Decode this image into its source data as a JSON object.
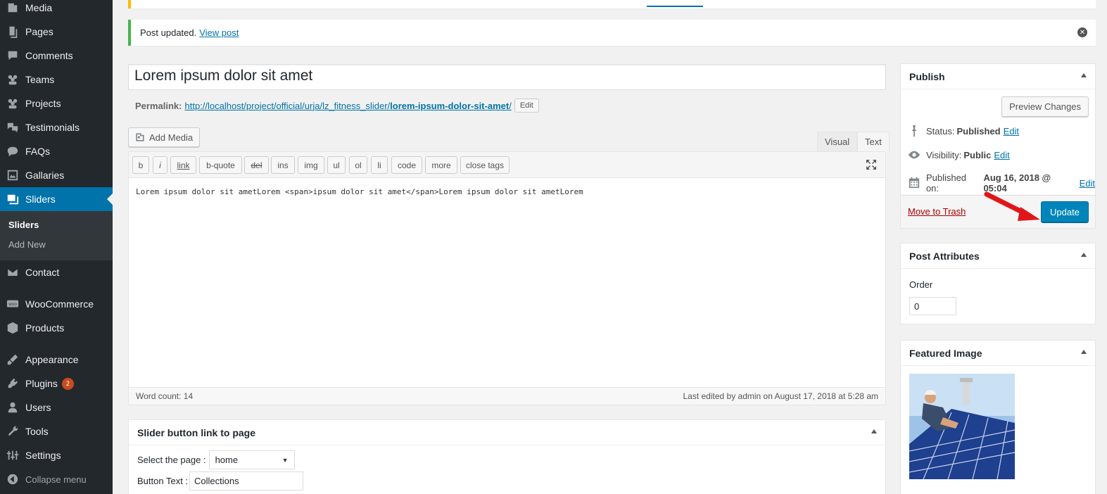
{
  "sidebar": {
    "items": [
      {
        "label": "Media",
        "icon": "media-icon"
      },
      {
        "label": "Pages",
        "icon": "pages-icon"
      },
      {
        "label": "Comments",
        "icon": "comments-icon"
      },
      {
        "label": "Teams",
        "icon": "teams-icon"
      },
      {
        "label": "Projects",
        "icon": "projects-icon"
      },
      {
        "label": "Testimonials",
        "icon": "testimonials-icon"
      },
      {
        "label": "FAQs",
        "icon": "faqs-icon"
      },
      {
        "label": "Gallaries",
        "icon": "gallaries-icon"
      },
      {
        "label": "Sliders",
        "icon": "sliders-icon"
      },
      {
        "label": "Contact",
        "icon": "contact-icon"
      },
      {
        "label": "WooCommerce",
        "icon": "woocommerce-icon"
      },
      {
        "label": "Products",
        "icon": "products-icon"
      },
      {
        "label": "Appearance",
        "icon": "appearance-icon"
      },
      {
        "label": "Plugins",
        "icon": "plugins-icon",
        "badge": "2"
      },
      {
        "label": "Users",
        "icon": "users-icon"
      },
      {
        "label": "Tools",
        "icon": "tools-icon"
      },
      {
        "label": "Settings",
        "icon": "settings-icon"
      }
    ],
    "submenu": [
      "Sliders",
      "Add New"
    ],
    "collapse": "Collapse menu"
  },
  "notice": {
    "text": "Post updated.",
    "link": "View post"
  },
  "editor": {
    "title": "Lorem ipsum dolor sit amet",
    "permalink_label": "Permalink:",
    "permalink_base": "http://localhost/project/official/urja/lz_fitness_slider/",
    "permalink_slug": "lorem-ipsum-dolor-sit-amet",
    "permalink_end": "/",
    "edit_label": "Edit",
    "add_media": "Add Media",
    "tab_visual": "Visual",
    "tab_text": "Text",
    "quicktags": [
      "b",
      "i",
      "link",
      "b-quote",
      "del",
      "ins",
      "img",
      "ul",
      "ol",
      "li",
      "code",
      "more",
      "close tags"
    ],
    "content": "Lorem ipsum dolor sit ametLorem <span>ipsum dolor sit amet</span>Lorem ipsum dolor sit ametLorem",
    "word_count": "Word count: 14",
    "last_edited": "Last edited by admin on August 17, 2018 at 5:28 am"
  },
  "slider_box": {
    "title": "Slider button link to page",
    "select_label": "Select the page :",
    "select_value": "home",
    "button_text_label": "Button Text :",
    "button_text_value": "Collections"
  },
  "publish": {
    "title": "Publish",
    "preview": "Preview Changes",
    "status_label": "Status:",
    "status_value": "Published",
    "visibility_label": "Visibility:",
    "visibility_value": "Public",
    "published_label": "Published on:",
    "published_value": "Aug 16, 2018 @ 05:04",
    "edit": "Edit",
    "trash": "Move to Trash",
    "update": "Update"
  },
  "attributes": {
    "title": "Post Attributes",
    "order_label": "Order",
    "order_value": "0"
  },
  "featured": {
    "title": "Featured Image"
  },
  "colors": {
    "sidebar_bg": "#23282d",
    "active": "#0073aa",
    "update_button": "#0085ba",
    "arrow": "#e1161b"
  }
}
